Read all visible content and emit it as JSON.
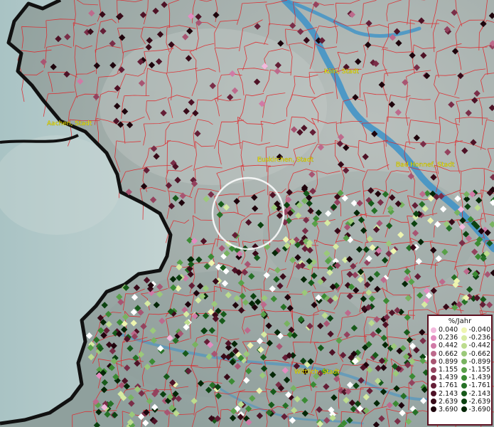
{
  "map": {
    "city_labels": [
      {
        "id": "koeln",
        "text": "Köln, Stadt"
      },
      {
        "id": "aachen",
        "text": "Aachen, Stadt"
      },
      {
        "id": "euskirchen",
        "text": "Euskirchen, Stadt"
      },
      {
        "id": "bad-honnef",
        "text": "Bad Honnef, Stadt"
      },
      {
        "id": "wittlich",
        "text": "Wittlich, Stadt"
      }
    ],
    "colors": {
      "river": "#3c92c8",
      "municipal_border": "#e0262a",
      "national_border": "#111111",
      "highlight_circle": "#ffffff"
    }
  },
  "legend": {
    "title": "%/Jahr",
    "positive": [
      {
        "value": "0.040",
        "color": "#f2b8dc"
      },
      {
        "value": "0.236",
        "color": "#e38cc0"
      },
      {
        "value": "0.442",
        "color": "#d07aa6"
      },
      {
        "value": "0.662",
        "color": "#bd6a8c"
      },
      {
        "value": "0.899",
        "color": "#a85572"
      },
      {
        "value": "1.155",
        "color": "#94425e"
      },
      {
        "value": "1.439",
        "color": "#7a2e48"
      },
      {
        "value": "1.761",
        "color": "#641e36"
      },
      {
        "value": "2.143",
        "color": "#4e1226"
      },
      {
        "value": "2.639",
        "color": "#380a18"
      },
      {
        "value": "3.690",
        "color": "#1e040c"
      }
    ],
    "negative": [
      {
        "value": "-0.040",
        "color": "#eef5b0"
      },
      {
        "value": "-0.236",
        "color": "#d6eba2"
      },
      {
        "value": "-0.442",
        "color": "#bcdc8e"
      },
      {
        "value": "-0.662",
        "color": "#9bc97a"
      },
      {
        "value": "-0.899",
        "color": "#78b360"
      },
      {
        "value": "-1.155",
        "color": "#58a048"
      },
      {
        "value": "-1.439",
        "color": "#3b8a33"
      },
      {
        "value": "-1.761",
        "color": "#267126"
      },
      {
        "value": "-2.143",
        "color": "#175a1a"
      },
      {
        "value": "-2.639",
        "color": "#0b4210"
      },
      {
        "value": "-3.690",
        "color": "#042606"
      }
    ]
  }
}
